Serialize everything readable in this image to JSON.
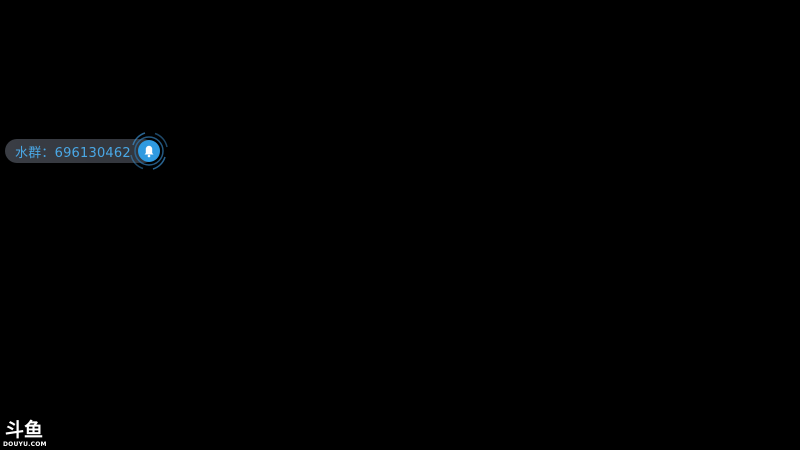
{
  "overlay": {
    "group_text": "水群：696130462",
    "bell_icon": "bell-icon",
    "accent_color": "#2f9ae0"
  },
  "watermark": {
    "logo_text": "斗鱼",
    "logo_subtext": "DOUYU.COM"
  }
}
